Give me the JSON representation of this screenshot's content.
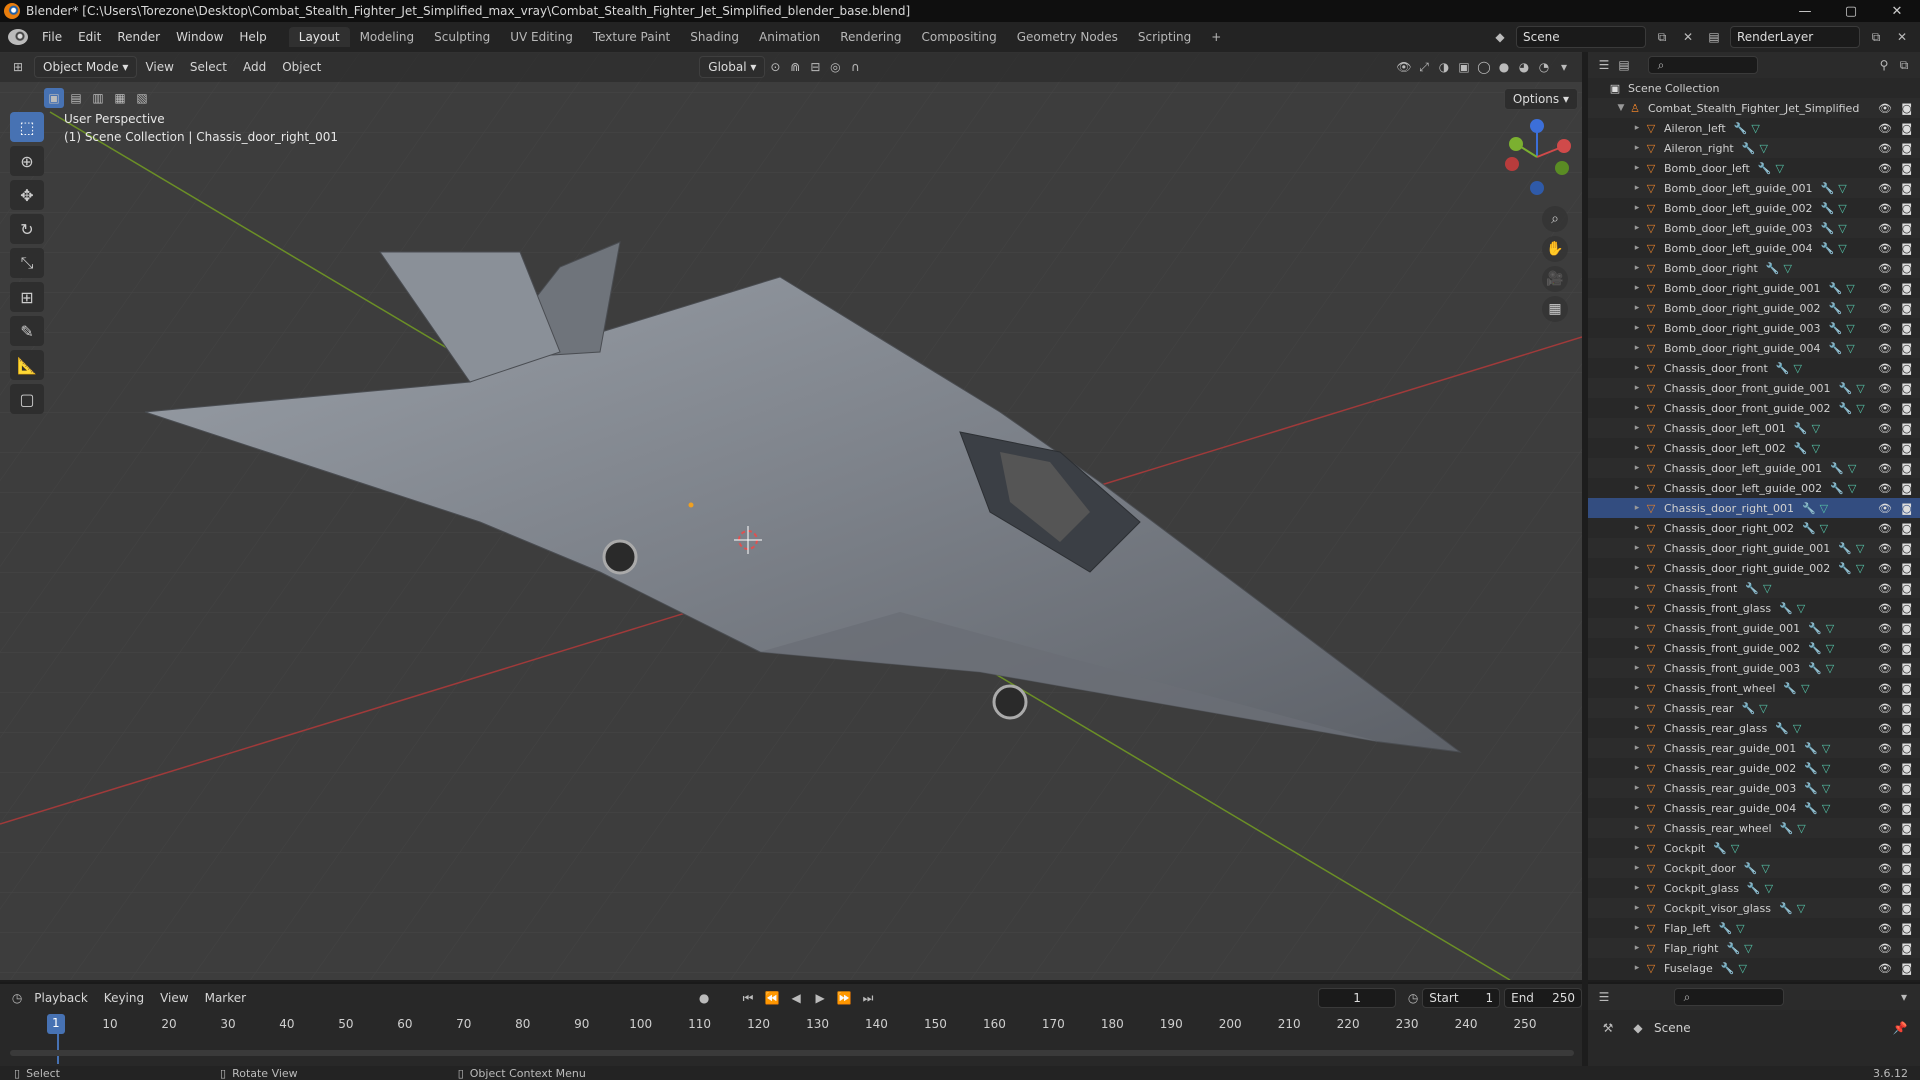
{
  "window": {
    "title": "Blender* [C:\\Users\\Torezone\\Desktop\\Combat_Stealth_Fighter_Jet_Simplified_max_vray\\Combat_Stealth_Fighter_Jet_Simplified_blender_base.blend]",
    "controls": [
      "—",
      "▢",
      "✕"
    ]
  },
  "menu": [
    "File",
    "Edit",
    "Render",
    "Window",
    "Help"
  ],
  "workspaces": [
    "Layout",
    "Modeling",
    "Sculpting",
    "UV Editing",
    "Texture Paint",
    "Shading",
    "Animation",
    "Rendering",
    "Compositing",
    "Geometry Nodes",
    "Scripting",
    "+"
  ],
  "scene": {
    "name": "Scene",
    "view_layer": "RenderLayer"
  },
  "viewport": {
    "mode": "Object Mode",
    "menus": [
      "View",
      "Select",
      "Add",
      "Object"
    ],
    "transform": "Global",
    "options": "Options",
    "perspective": "User Perspective",
    "context": "(1) Scene Collection | Chassis_door_right_001"
  },
  "outliner": {
    "root": "Scene Collection",
    "collection": "Combat_Stealth_Fighter_Jet_Simplified",
    "selected": "Chassis_door_right_001",
    "items": [
      "Aileron_left",
      "Aileron_right",
      "Bomb_door_left",
      "Bomb_door_left_guide_001",
      "Bomb_door_left_guide_002",
      "Bomb_door_left_guide_003",
      "Bomb_door_left_guide_004",
      "Bomb_door_right",
      "Bomb_door_right_guide_001",
      "Bomb_door_right_guide_002",
      "Bomb_door_right_guide_003",
      "Bomb_door_right_guide_004",
      "Chassis_door_front",
      "Chassis_door_front_guide_001",
      "Chassis_door_front_guide_002",
      "Chassis_door_left_001",
      "Chassis_door_left_002",
      "Chassis_door_left_guide_001",
      "Chassis_door_left_guide_002",
      "Chassis_door_right_001",
      "Chassis_door_right_002",
      "Chassis_door_right_guide_001",
      "Chassis_door_right_guide_002",
      "Chassis_front",
      "Chassis_front_glass",
      "Chassis_front_guide_001",
      "Chassis_front_guide_002",
      "Chassis_front_guide_003",
      "Chassis_front_wheel",
      "Chassis_rear",
      "Chassis_rear_glass",
      "Chassis_rear_guide_001",
      "Chassis_rear_guide_002",
      "Chassis_rear_guide_003",
      "Chassis_rear_guide_004",
      "Chassis_rear_wheel",
      "Cockpit",
      "Cockpit_door",
      "Cockpit_glass",
      "Cockpit_visor_glass",
      "Flap_left",
      "Flap_right",
      "Fuselage"
    ]
  },
  "properties": {
    "scene": "Scene"
  },
  "timeline": {
    "menus": [
      "Playback",
      "Keying",
      "View",
      "Marker"
    ],
    "current": "1",
    "start_label": "Start",
    "start": "1",
    "end_label": "End",
    "end": "250",
    "ticks": [
      "1",
      "10",
      "20",
      "30",
      "40",
      "50",
      "60",
      "70",
      "80",
      "90",
      "100",
      "110",
      "120",
      "130",
      "140",
      "150",
      "160",
      "170",
      "180",
      "190",
      "200",
      "210",
      "220",
      "230",
      "240",
      "250"
    ]
  },
  "status": {
    "select": "Select",
    "rotate": "Rotate View",
    "context": "Object Context Menu",
    "version": "3.6.12"
  }
}
